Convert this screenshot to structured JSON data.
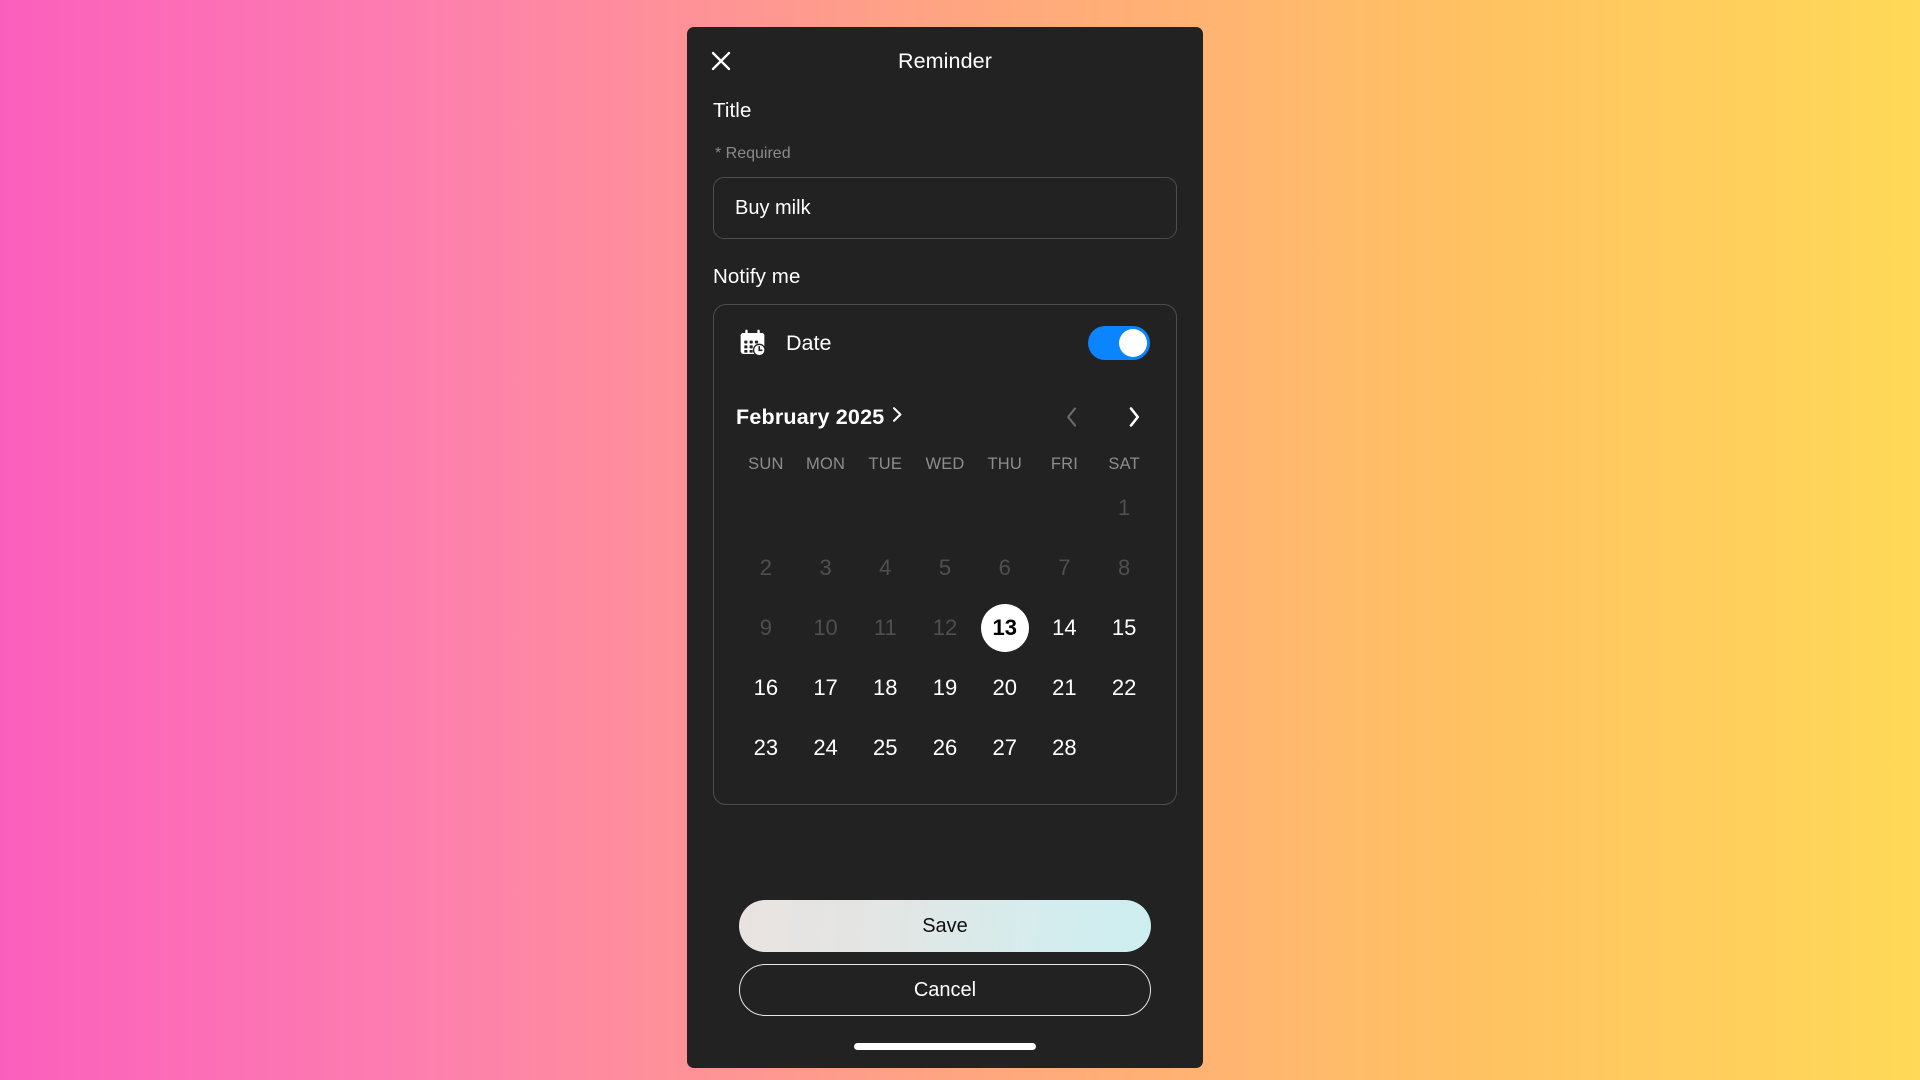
{
  "background": {
    "gradient_from": "#fb5fbd",
    "gradient_mid": "#ffa87e",
    "gradient_to": "#ffd957"
  },
  "titlebar": {
    "title": "Reminder",
    "close_icon": "close-x-icon"
  },
  "form": {
    "title_label": "Title",
    "required_note": "* Required",
    "title_value": "Buy milk",
    "title_placeholder": "Title",
    "notify_label": "Notify me"
  },
  "date_row": {
    "icon": "calendar-clock-icon",
    "label": "Date",
    "toggle_on": true,
    "toggle_color": "#0a84ff"
  },
  "calendar": {
    "month_label": "February 2025",
    "month_expand_icon": "chevron-right-icon",
    "prev_icon": "chevron-left-icon",
    "next_icon": "chevron-right-icon",
    "prev_enabled": false,
    "next_enabled": true,
    "weekdays": [
      "SUN",
      "MON",
      "TUE",
      "WED",
      "THU",
      "FRI",
      "SAT"
    ],
    "leading_blanks": 6,
    "days": [
      {
        "n": "1",
        "state": "muted"
      },
      {
        "n": "2",
        "state": "muted"
      },
      {
        "n": "3",
        "state": "muted"
      },
      {
        "n": "4",
        "state": "muted"
      },
      {
        "n": "5",
        "state": "muted"
      },
      {
        "n": "6",
        "state": "muted"
      },
      {
        "n": "7",
        "state": "muted"
      },
      {
        "n": "8",
        "state": "muted"
      },
      {
        "n": "9",
        "state": "muted"
      },
      {
        "n": "10",
        "state": "muted"
      },
      {
        "n": "11",
        "state": "muted"
      },
      {
        "n": "12",
        "state": "muted"
      },
      {
        "n": "13",
        "state": "selected"
      },
      {
        "n": "14",
        "state": "normal"
      },
      {
        "n": "15",
        "state": "normal"
      },
      {
        "n": "16",
        "state": "normal"
      },
      {
        "n": "17",
        "state": "normal"
      },
      {
        "n": "18",
        "state": "normal"
      },
      {
        "n": "19",
        "state": "normal"
      },
      {
        "n": "20",
        "state": "normal"
      },
      {
        "n": "21",
        "state": "normal"
      },
      {
        "n": "22",
        "state": "normal"
      },
      {
        "n": "23",
        "state": "normal"
      },
      {
        "n": "24",
        "state": "normal"
      },
      {
        "n": "25",
        "state": "normal"
      },
      {
        "n": "26",
        "state": "normal"
      },
      {
        "n": "27",
        "state": "normal"
      },
      {
        "n": "28",
        "state": "normal"
      }
    ],
    "selected_day": "13"
  },
  "actions": {
    "save_label": "Save",
    "cancel_label": "Cancel",
    "save_gradient_from": "#e9e3e1",
    "save_gradient_to": "#cdeef0"
  },
  "system": {
    "home_indicator": true
  }
}
